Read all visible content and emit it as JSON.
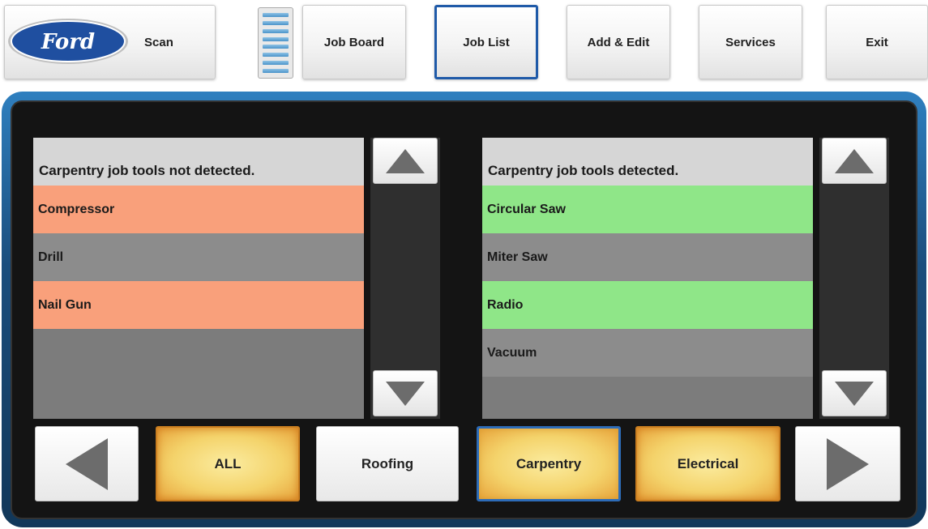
{
  "brand": {
    "logo_text": "Ford",
    "logo_color": "#1f4fa0"
  },
  "toolbar": {
    "scan_label": "Scan",
    "job_board_label": "Job Board",
    "job_list_label": "Job List",
    "add_edit_label": "Add & Edit",
    "services_label": "Services",
    "exit_label": "Exit",
    "active_tab": "Job List"
  },
  "lists": {
    "not_detected": {
      "header": "Carpentry job tools not detected.",
      "items": [
        "Compressor",
        "Drill",
        "Nail Gun"
      ]
    },
    "detected": {
      "header": "Carpentry job tools detected.",
      "items": [
        "Circular Saw",
        "Miter Saw",
        "Radio",
        "Vacuum"
      ]
    }
  },
  "categories": {
    "all_label": "ALL",
    "roofing_label": "Roofing",
    "carpentry_label": "Carpentry",
    "electrical_label": "Electrical",
    "selected": "Carpentry"
  },
  "colors": {
    "missing": "#f9a07b",
    "found": "#8fe688",
    "accent": "#1f5aa8"
  }
}
